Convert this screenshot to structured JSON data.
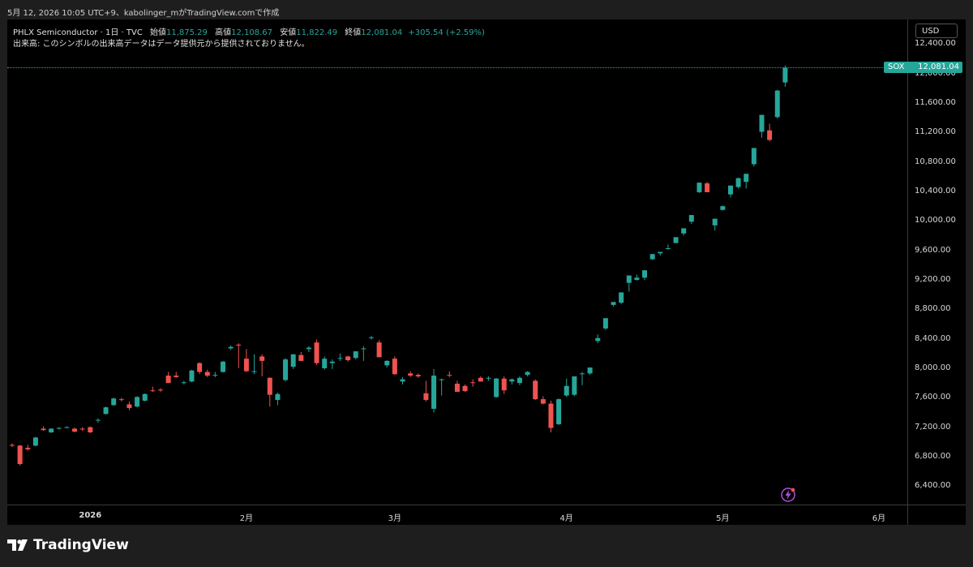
{
  "header": {
    "watermark": "5月 12, 2026 10:05 UTC+9、kabolinger_mがTradingView.comで作成"
  },
  "legend": {
    "symbol": "PHLX Semiconductor · 1日 · TVC",
    "open_label": "始値",
    "open_value": "11,875.29",
    "high_label": "高値",
    "high_value": "12,108.67",
    "low_label": "安値",
    "low_value": "11,822.49",
    "close_label": "終値",
    "close_value": "12,081.04",
    "change": "+305.54 (+2.59%)",
    "volume_note": "出来高: このシンボルの出来高データはデータ提供元から提供されておりません。"
  },
  "currency_button": "USD",
  "price_label": {
    "symbol": "SOX",
    "value": "12,081.04"
  },
  "footer": {
    "brand": "TradingView"
  },
  "colors": {
    "up": "#26a69a",
    "down": "#ef5350",
    "background": "#000000"
  },
  "icons": {
    "flash": "lightning-icon",
    "logo": "tradingview-logo-icon"
  },
  "chart_data": {
    "type": "candlestick",
    "yticks": [
      "12,400.00",
      "12,000.00",
      "11,600.00",
      "11,200.00",
      "10,800.00",
      "10,400.00",
      "10,000.00",
      "9,600.00",
      "9,200.00",
      "8,800.00",
      "8,400.00",
      "8,000.00",
      "7,600.00",
      "7,200.00",
      "6,800.00",
      "6,400.00"
    ],
    "ytick_values": [
      12400,
      12000,
      11600,
      11200,
      10800,
      10400,
      10000,
      9600,
      9200,
      8800,
      8400,
      8000,
      7600,
      7200,
      6800,
      6400
    ],
    "ylim": [
      6150,
      12735
    ],
    "xticks": [
      {
        "label": "2026",
        "index": 10,
        "bold": true
      },
      {
        "label": "2月",
        "index": 30,
        "bold": false
      },
      {
        "label": "3月",
        "index": 49,
        "bold": false
      },
      {
        "label": "4月",
        "index": 71,
        "bold": false
      },
      {
        "label": "5月",
        "index": 91,
        "bold": false
      },
      {
        "label": "6月",
        "index": 111,
        "bold": false
      }
    ],
    "last_price": 12081.04,
    "candles": [
      [
        6960,
        6980,
        6930,
        6950
      ],
      [
        6950,
        6960,
        6680,
        6700
      ],
      [
        6920,
        6960,
        6880,
        6900
      ],
      [
        6950,
        7070,
        6940,
        7060
      ],
      [
        7180,
        7210,
        7150,
        7160
      ],
      [
        7130,
        7185,
        7120,
        7180
      ],
      [
        7180,
        7200,
        7170,
        7190
      ],
      [
        7200,
        7215,
        7190,
        7200
      ],
      [
        7180,
        7195,
        7130,
        7140
      ],
      [
        7180,
        7200,
        7150,
        7170
      ],
      [
        7200,
        7210,
        7120,
        7130
      ],
      [
        7290,
        7320,
        7260,
        7300
      ],
      [
        7380,
        7480,
        7370,
        7470
      ],
      [
        7500,
        7600,
        7490,
        7590
      ],
      [
        7580,
        7600,
        7550,
        7570
      ],
      [
        7510,
        7550,
        7430,
        7460
      ],
      [
        7480,
        7620,
        7470,
        7610
      ],
      [
        7560,
        7660,
        7550,
        7650
      ],
      [
        7700,
        7750,
        7680,
        7690
      ],
      [
        7710,
        7730,
        7680,
        7700
      ],
      [
        7900,
        7950,
        7800,
        7800
      ],
      [
        7900,
        7950,
        7870,
        7880
      ],
      [
        7800,
        7830,
        7780,
        7810
      ],
      [
        7820,
        7980,
        7810,
        7970
      ],
      [
        8070,
        8080,
        7920,
        7950
      ],
      [
        7950,
        7980,
        7880,
        7900
      ],
      [
        7900,
        7950,
        7880,
        7910
      ],
      [
        7950,
        8100,
        7940,
        8090
      ],
      [
        8270,
        8310,
        8250,
        8290
      ],
      [
        8320,
        8340,
        8000,
        8310
      ],
      [
        8130,
        8260,
        7950,
        7960
      ],
      [
        7960,
        8190,
        7920,
        7960
      ],
      [
        8160,
        8190,
        7890,
        8100
      ],
      [
        7870,
        7880,
        7480,
        7640
      ],
      [
        7570,
        7670,
        7500,
        7650
      ],
      [
        7840,
        8140,
        7820,
        8120
      ],
      [
        8020,
        8180,
        7990,
        8190
      ],
      [
        8180,
        8220,
        8100,
        8100
      ],
      [
        8260,
        8300,
        8220,
        8280
      ],
      [
        8350,
        8390,
        8040,
        8070
      ],
      [
        8000,
        8160,
        7980,
        8130
      ],
      [
        8070,
        8120,
        7990,
        8090
      ],
      [
        8130,
        8200,
        8100,
        8140
      ],
      [
        8160,
        8170,
        8090,
        8110
      ],
      [
        8140,
        8230,
        8120,
        8230
      ],
      [
        8260,
        8300,
        8100,
        8270
      ],
      [
        8410,
        8440,
        8390,
        8420
      ],
      [
        8350,
        8380,
        8160,
        8150
      ],
      [
        8040,
        8110,
        8010,
        8100
      ],
      [
        8130,
        8160,
        7910,
        7920
      ],
      [
        7820,
        7880,
        7780,
        7850
      ],
      [
        7930,
        7960,
        7880,
        7900
      ],
      [
        7910,
        7930,
        7870,
        7890
      ],
      [
        7660,
        7830,
        7550,
        7570
      ],
      [
        7450,
        7990,
        7400,
        7900
      ],
      [
        7840,
        7860,
        7630,
        7850
      ],
      [
        7910,
        7960,
        7880,
        7900
      ],
      [
        7790,
        7830,
        7680,
        7680
      ],
      [
        7760,
        7780,
        7680,
        7690
      ],
      [
        7810,
        7850,
        7750,
        7800
      ],
      [
        7870,
        7890,
        7840,
        7820
      ],
      [
        7860,
        7890,
        7830,
        7870
      ],
      [
        7610,
        7870,
        7600,
        7860
      ],
      [
        7860,
        7890,
        7650,
        7700
      ],
      [
        7820,
        7860,
        7780,
        7850
      ],
      [
        7800,
        7890,
        7770,
        7870
      ],
      [
        7910,
        7960,
        7890,
        7950
      ],
      [
        7830,
        7850,
        7570,
        7580
      ],
      [
        7580,
        7620,
        7510,
        7520
      ],
      [
        7520,
        7560,
        7130,
        7190
      ],
      [
        7240,
        7590,
        7230,
        7580
      ],
      [
        7630,
        7860,
        7610,
        7760
      ],
      [
        7640,
        7810,
        7620,
        7890
      ],
      [
        7920,
        7950,
        7770,
        7930
      ],
      [
        7930,
        8010,
        7910,
        8010
      ],
      [
        8370,
        8460,
        8340,
        8410
      ],
      [
        8540,
        8560,
        8520,
        8680
      ],
      [
        8860,
        8890,
        8840,
        8900
      ],
      [
        8890,
        8920,
        8870,
        9030
      ],
      [
        9160,
        9230,
        9040,
        9260
      ],
      [
        9200,
        9270,
        9190,
        9230
      ],
      [
        9230,
        9330,
        9200,
        9330
      ],
      [
        9480,
        9540,
        9470,
        9550
      ],
      [
        9560,
        9580,
        9530,
        9580
      ],
      [
        9620,
        9680,
        9610,
        9630
      ],
      [
        9700,
        9780,
        9700,
        9780
      ],
      [
        9830,
        9900,
        9800,
        9900
      ],
      [
        9990,
        10070,
        9960,
        10080
      ],
      [
        10390,
        10480,
        10380,
        10520
      ],
      [
        10510,
        10530,
        10400,
        10390
      ],
      [
        9940,
        10020,
        9870,
        10030
      ],
      [
        10150,
        10210,
        10140,
        10200
      ],
      [
        10360,
        10480,
        10320,
        10480
      ],
      [
        10460,
        10590,
        10440,
        10580
      ],
      [
        10530,
        10540,
        10440,
        10640
      ],
      [
        10770,
        10980,
        10740,
        10990
      ],
      [
        11210,
        11250,
        11130,
        11440
      ],
      [
        11230,
        11320,
        11080,
        11100
      ],
      [
        11410,
        11780,
        11390,
        11770
      ],
      [
        11880,
        12110,
        11820,
        12081
      ]
    ]
  }
}
